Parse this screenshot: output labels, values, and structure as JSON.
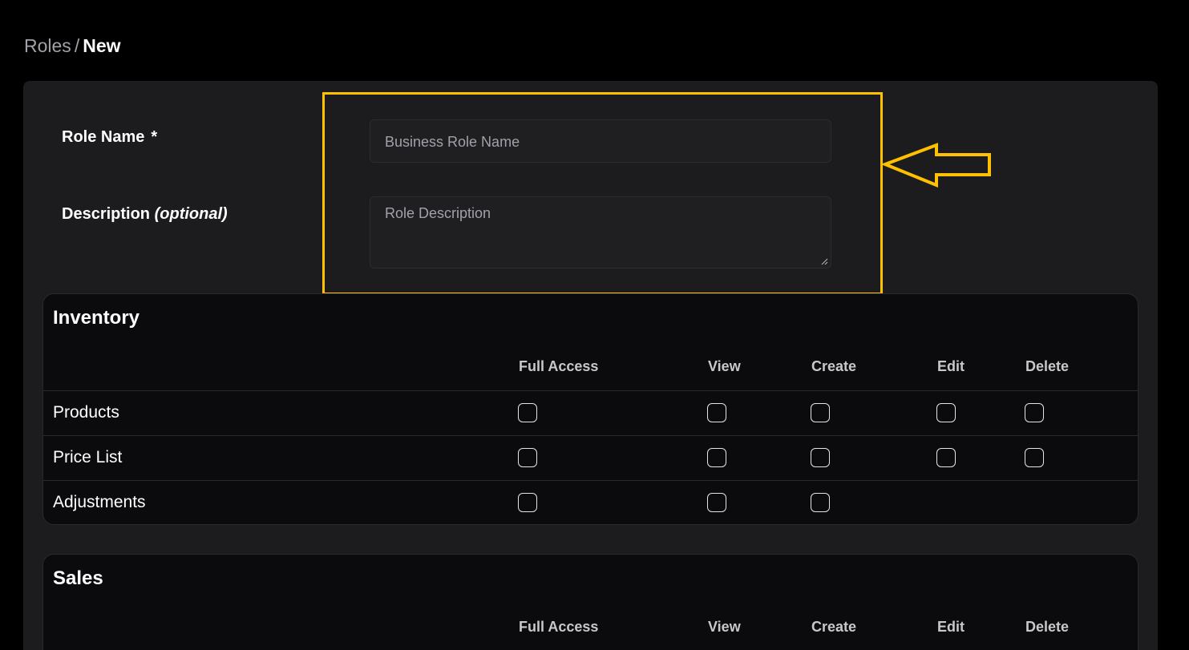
{
  "breadcrumb": {
    "parent": "Roles",
    "separator": "/",
    "current": "New"
  },
  "form": {
    "role_name_label": "Role Name",
    "required_mark": "*",
    "role_name_placeholder": "Business Role Name",
    "description_label": "Description",
    "description_optional": "(optional)",
    "description_placeholder": "Role Description"
  },
  "annotation": {
    "highlight_color": "#ffc000",
    "arrow_icon": "left-arrow-outline"
  },
  "columns": [
    "Full Access",
    "View",
    "Create",
    "Edit",
    "Delete"
  ],
  "sections": [
    {
      "title": "Inventory",
      "rows": [
        {
          "label": "Products",
          "permissions": [
            false,
            false,
            false,
            false,
            false
          ]
        },
        {
          "label": "Price List",
          "permissions": [
            false,
            false,
            false,
            false,
            false
          ]
        },
        {
          "label": "Adjustments",
          "permissions": [
            false,
            false,
            false
          ]
        }
      ]
    },
    {
      "title": "Sales",
      "rows": []
    }
  ]
}
